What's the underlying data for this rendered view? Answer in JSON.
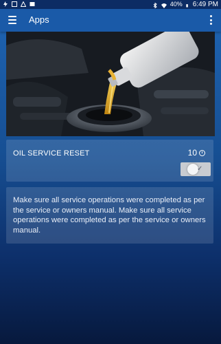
{
  "status_bar": {
    "battery": "40%",
    "time": "6:49 PM"
  },
  "app_bar": {
    "title": "Apps"
  },
  "service_card": {
    "title": "OIL SERVICE RESET",
    "counter": "10",
    "toggle_on": true
  },
  "info_card": {
    "text": "Make sure all service operations were completed as per the service or owners manual. Make sure all service operations were completed as per the service or owners manual."
  },
  "colors": {
    "app_bar": "#1a5aa8",
    "status_bar": "#0c2c64",
    "background_top": "#1f65b4",
    "background_bottom": "#07193d"
  }
}
